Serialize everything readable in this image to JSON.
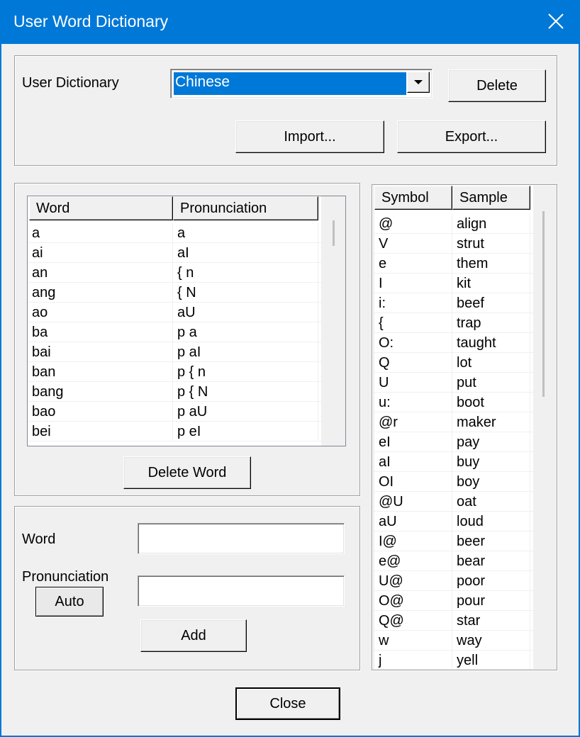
{
  "window": {
    "title": "User Word Dictionary"
  },
  "dictionary": {
    "label": "User Dictionary",
    "selected": "Chinese",
    "delete_label": "Delete",
    "import_label": "Import...",
    "export_label": "Export..."
  },
  "word_list": {
    "columns": [
      "Word",
      "Pronunciation"
    ],
    "rows": [
      [
        "a",
        "a"
      ],
      [
        "ai",
        "aI"
      ],
      [
        "an",
        "{ n"
      ],
      [
        "ang",
        "{ N"
      ],
      [
        "ao",
        "aU"
      ],
      [
        "ba",
        "p a"
      ],
      [
        "bai",
        "p aI"
      ],
      [
        "ban",
        "p { n"
      ],
      [
        "bang",
        "p { N"
      ],
      [
        "bao",
        "p aU"
      ],
      [
        "bei",
        "p eI"
      ]
    ],
    "delete_word_label": "Delete Word"
  },
  "add_form": {
    "word_label": "Word",
    "word_value": "",
    "pronunciation_label": "Pronunciation",
    "pronunciation_value": "",
    "auto_label": "Auto",
    "add_label": "Add"
  },
  "symbols": {
    "columns": [
      "Symbol",
      "Sample"
    ],
    "rows": [
      [
        "@",
        "align"
      ],
      [
        "V",
        "strut"
      ],
      [
        "e",
        "them"
      ],
      [
        "I",
        "kit"
      ],
      [
        "i:",
        "beef"
      ],
      [
        "{",
        "trap"
      ],
      [
        "O:",
        "taught"
      ],
      [
        "Q",
        "lot"
      ],
      [
        "U",
        "put"
      ],
      [
        "u:",
        "boot"
      ],
      [
        "@r",
        "maker"
      ],
      [
        "eI",
        "pay"
      ],
      [
        "aI",
        "buy"
      ],
      [
        "OI",
        "boy"
      ],
      [
        "@U",
        "oat"
      ],
      [
        "aU",
        "loud"
      ],
      [
        "I@",
        "beer"
      ],
      [
        "e@",
        "bear"
      ],
      [
        "U@",
        "poor"
      ],
      [
        "O@",
        "pour"
      ],
      [
        "Q@",
        "star"
      ],
      [
        "w",
        "way"
      ],
      [
        "j",
        "yell"
      ]
    ]
  },
  "footer": {
    "close_label": "Close"
  },
  "colors": {
    "accent": "#0078d7",
    "face": "#f0f0f0"
  },
  "icons": {
    "close": "close-icon",
    "dropdown": "chevron-down-icon"
  }
}
